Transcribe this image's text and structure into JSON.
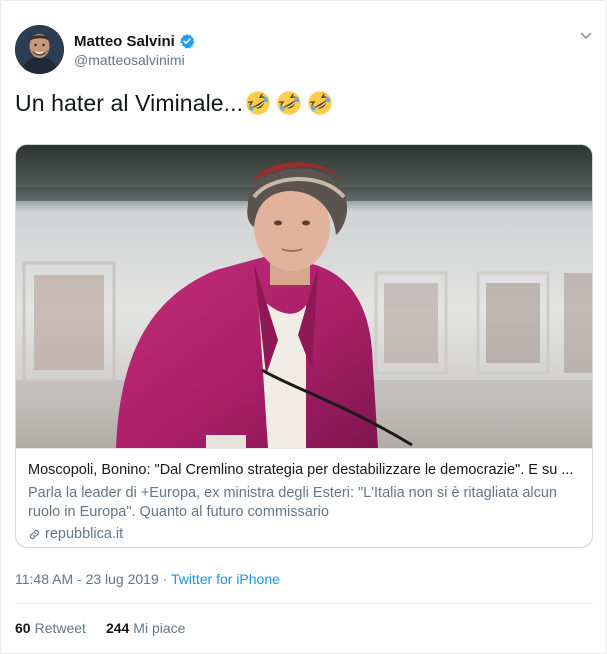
{
  "author": {
    "display_name": "Matteo Salvini",
    "handle": "@matteosalvinimi",
    "verified": true
  },
  "tweet": {
    "text": "Un hater al Viminale...",
    "emoji": [
      "rolling-on-floor-laughing",
      "rolling-on-floor-laughing",
      "rolling-on-floor-laughing"
    ]
  },
  "card": {
    "title": "Moscopoli, Bonino: \"Dal Cremlino strategia per destabilizzare le democrazie\". E su ...",
    "description": "Parla la leader di +Europa, ex ministra degli Esteri: \"L'Italia non si è ritagliata alcun ruolo in Europa\". Quanto al futuro commissario",
    "domain": "repubblica.it"
  },
  "meta": {
    "time": "11:48 AM",
    "separator": " - ",
    "date": "23 lug 2019",
    "dot": " · ",
    "source": "Twitter for iPhone"
  },
  "stats": {
    "retweets_count": "60",
    "retweets_label": "Retweet",
    "likes_count": "244",
    "likes_label": "Mi piace"
  },
  "colors": {
    "link_blue": "#1b95e0",
    "verified_blue": "#1da1f2",
    "secondary_text": "#657786",
    "jacket_magenta": "#b5246e"
  }
}
